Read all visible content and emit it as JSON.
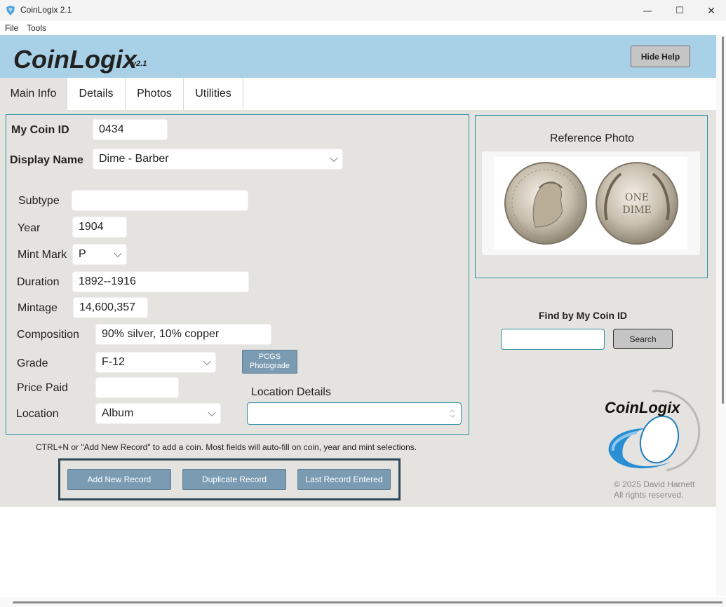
{
  "window": {
    "title": "CoinLogix 2.1",
    "minimize_glyph": "—",
    "maximize_glyph": "☐",
    "close_glyph": "✕"
  },
  "menu": {
    "items": [
      "File",
      "Tools"
    ]
  },
  "header": {
    "brand": "CoinLogix",
    "version": "v2.1",
    "hide_help_label": "Hide Help"
  },
  "tabs": [
    {
      "label": "Main Info",
      "active": true
    },
    {
      "label": "Details",
      "active": false
    },
    {
      "label": "Photos",
      "active": false
    },
    {
      "label": "Utilities",
      "active": false
    }
  ],
  "form": {
    "coin_id_label": "My Coin ID",
    "coin_id_value": "0434",
    "display_name_label": "Display Name",
    "display_name_value": "Dime - Barber",
    "subtype_label": "Subtype",
    "subtype_value": "",
    "year_label": "Year",
    "year_value": "1904",
    "mint_mark_label": "Mint Mark",
    "mint_mark_value": "P",
    "duration_label": "Duration",
    "duration_value": "1892--1916",
    "mintage_label": "Mintage",
    "mintage_value": "14,600,357",
    "composition_label": "Composition",
    "composition_value": "90% silver, 10% copper",
    "grade_label": "Grade",
    "grade_value": "F-12",
    "pcgs_button": [
      "PCGS",
      "Photograde"
    ],
    "price_paid_label": "Price Paid",
    "price_paid_value": "",
    "location_label": "Location",
    "location_value": "Album",
    "location_details_label": "Location Details",
    "location_details_value": ""
  },
  "reference": {
    "title": "Reference Photo",
    "reverse_line1": "ONE",
    "reverse_line2": "DIME"
  },
  "find": {
    "label": "Find by My Coin ID",
    "input_value": "",
    "search_label": "Search"
  },
  "hint": "CTRL+N or \"Add New Record\" to add a coin. Most fields will auto-fill on coin, year and mint selections.",
  "actions": {
    "add_new": "Add New Record",
    "duplicate": "Duplicate Record",
    "last_entered": "Last Record Entered"
  },
  "footer": {
    "logo_text": "CoinLogix",
    "copyright_line1": "© 2025 David Harnett",
    "copyright_line2": "All rights reserved."
  },
  "colors": {
    "header_bg": "#a8d1e7",
    "content_bg": "#e4e3df",
    "panel_border": "#2f8fa3",
    "action_button": "#7b9bb2",
    "button_box_border": "#30495a"
  }
}
